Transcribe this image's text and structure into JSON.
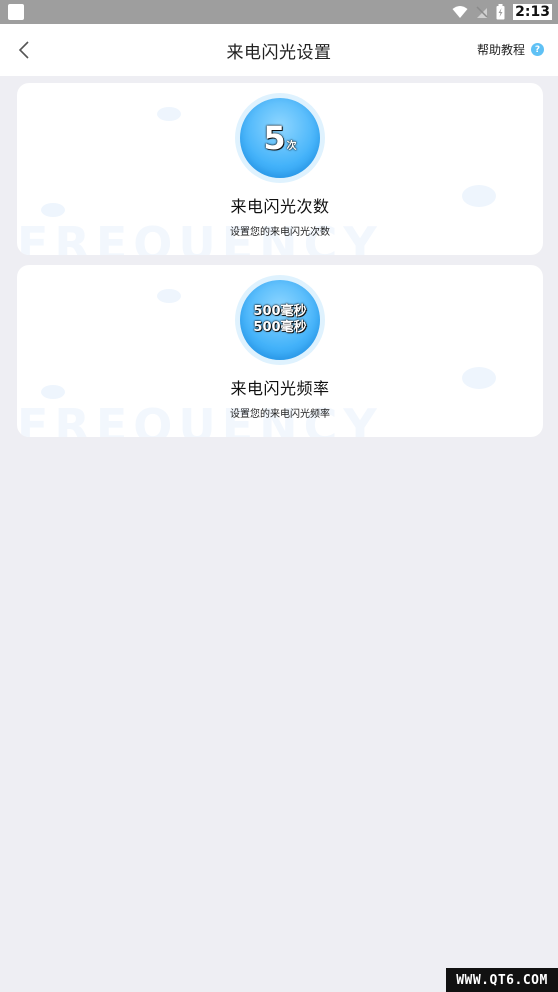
{
  "status_bar": {
    "time": "2:13"
  },
  "header": {
    "title": "来电闪光设置",
    "help_label": "帮助教程",
    "help_icon_glyph": "?"
  },
  "cards": [
    {
      "badge_number": "5",
      "badge_unit": "次",
      "title": "来电闪光次数",
      "subtitle": "设置您的来电闪光次数",
      "bg_word": "FREQUENCY"
    },
    {
      "badge_line_1": "500毫秒",
      "badge_line_2": "500毫秒",
      "title": "来电闪光频率",
      "subtitle": "设置您的来电闪光频率",
      "bg_word": "FREQUENCY"
    }
  ],
  "watermark": "WWW.QT6.COM",
  "colors": {
    "accent": "#44b3fa",
    "page_bg": "#eeeef3"
  },
  "icons": {
    "back": "chevron-left-icon",
    "help": "question-circle-icon"
  }
}
